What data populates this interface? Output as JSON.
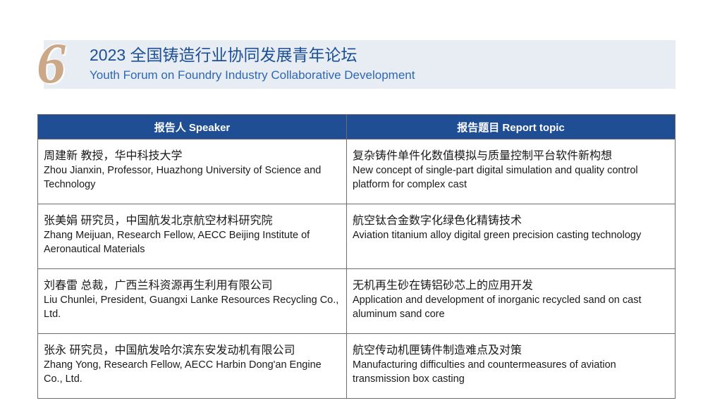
{
  "header": {
    "number": "6",
    "title_cn": "2023 全国铸造行业协同发展青年论坛",
    "title_en": "Youth Forum on Foundry Industry Collaborative Development"
  },
  "table": {
    "headers": [
      "报告人 Speaker",
      "报告题目 Report topic"
    ],
    "rows": [
      {
        "speaker_cn": "周建新 教授，华中科技大学",
        "speaker_en": "Zhou Jianxin, Professor, Huazhong University of Science and Technology",
        "topic_cn": "复杂铸件单件化数值模拟与质量控制平台软件新构想",
        "topic_en": "New concept of single-part digital simulation and quality control platform for complex cast"
      },
      {
        "speaker_cn": "张美娟 研究员，中国航发北京航空材料研究院",
        "speaker_en": "Zhang Meijuan, Research Fellow, AECC Beijing Institute of Aeronautical Materials",
        "topic_cn": "航空钛合金数字化绿色化精铸技术",
        "topic_en": "Aviation titanium alloy digital green precision casting technology"
      },
      {
        "speaker_cn": "刘春雷 总裁，广西兰科资源再生利用有限公司",
        "speaker_en": "Liu Chunlei, President, Guangxi Lanke Resources Recycling Co., Ltd.",
        "topic_cn": "无机再生砂在铸铝砂芯上的应用开发",
        "topic_en": "Application and development of inorganic recycled sand on cast aluminum sand core"
      },
      {
        "speaker_cn": "张永 研究员，中国航发哈尔滨东安发动机有限公司",
        "speaker_en": "Zhang Yong, Research Fellow, AECC Harbin Dong'an Engine Co., Ltd.",
        "topic_cn": "航空传动机匣铸件制造难点及对策",
        "topic_en": "Manufacturing difficulties and countermeasures of aviation transmission box casting"
      }
    ]
  }
}
